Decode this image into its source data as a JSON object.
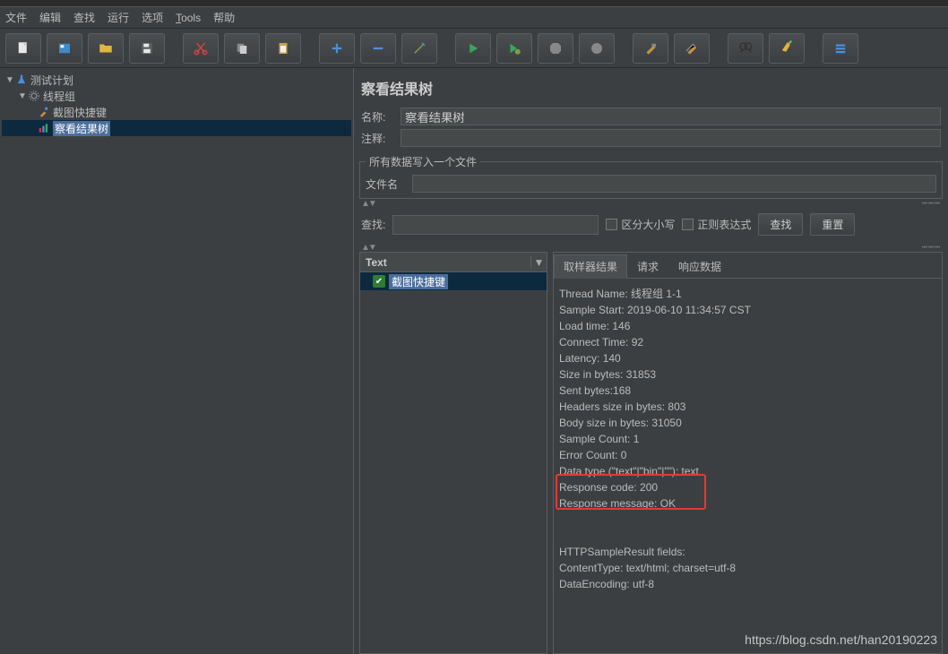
{
  "menu": {
    "file": "文件",
    "edit": "编辑",
    "search": "查找",
    "run": "运行",
    "options": "选项",
    "tools": "Tools",
    "help": "帮助"
  },
  "tree": {
    "plan": "测试计划",
    "thread_group": "线程组",
    "screenshot": "截图快捷键",
    "view_results": "察看结果树"
  },
  "main": {
    "title": "察看结果树",
    "name_label": "名称:",
    "name_value": "察看结果树",
    "comment_label": "注释:",
    "write_legend": "所有数据写入一个文件",
    "filename_label": "文件名",
    "search_label": "查找:",
    "chk_case": "区分大小写",
    "chk_regex": "正则表达式",
    "search_btn": "查找",
    "reset_btn": "重置"
  },
  "results": {
    "col_text": "Text",
    "sample_name": "截图快捷键"
  },
  "tabs": {
    "sampler": "取样器结果",
    "request": "请求",
    "response": "响应数据"
  },
  "detail": {
    "l1": "Thread Name: 线程组 1-1",
    "l2": "Sample Start: 2019-06-10 11:34:57 CST",
    "l3": "Load time: 146",
    "l4": "Connect Time: 92",
    "l5": "Latency: 140",
    "l6": "Size in bytes: 31853",
    "l7": "Sent bytes:168",
    "l8": "Headers size in bytes: 803",
    "l9": "Body size in bytes: 31050",
    "l10": "Sample Count: 1",
    "l11": "Error Count: 0",
    "l12": "Data type (\"text\"|\"bin\"|\"\"): text",
    "l13": "Response code: 200",
    "l14": "Response message: OK",
    "l15": "",
    "l16": "",
    "l17": "HTTPSampleResult fields:",
    "l18": "ContentType: text/html; charset=utf-8",
    "l19": "DataEncoding: utf-8"
  },
  "watermark": "https://blog.csdn.net/han20190223"
}
